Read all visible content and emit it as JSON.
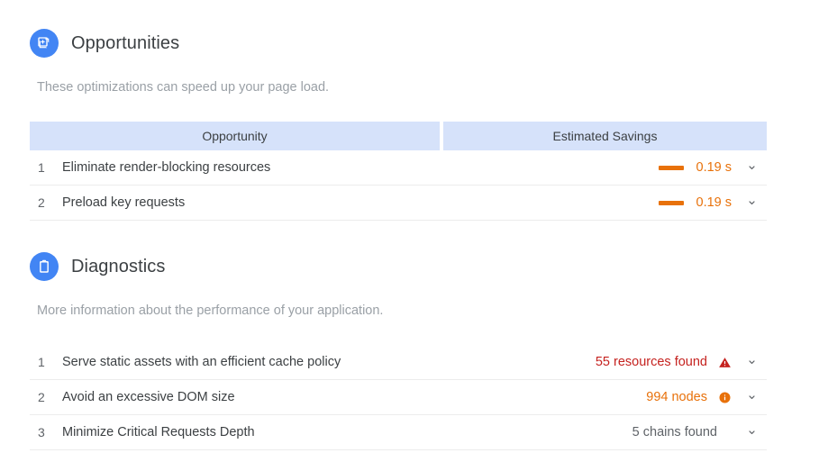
{
  "sections": [
    {
      "id": "opportunities",
      "icon_name": "opportunities-badge-icon",
      "title": "Opportunities",
      "subtitle": "These optimizations can speed up your page load.",
      "columns": {
        "left": "Opportunity",
        "right": "Estimated Savings"
      },
      "rows": [
        {
          "num": "1",
          "label": "Eliminate render-blocking resources",
          "value": "0.19 s",
          "value_color": "#e8710a",
          "has_bar": true,
          "bar_color": "#e8710a",
          "status_icon": "",
          "chevron": "chevron-down-icon"
        },
        {
          "num": "2",
          "label": "Preload key requests",
          "value": "0.19 s",
          "value_color": "#e8710a",
          "has_bar": true,
          "bar_color": "#e8710a",
          "status_icon": "",
          "chevron": "chevron-down-icon"
        }
      ]
    },
    {
      "id": "diagnostics",
      "icon_name": "diagnostics-clipboard-icon",
      "title": "Diagnostics",
      "subtitle": "More information about the performance of your application.",
      "columns": null,
      "rows": [
        {
          "num": "1",
          "label": "Serve static assets with an efficient cache policy",
          "value": "55 resources found",
          "value_color": "#c5221f",
          "has_bar": false,
          "bar_color": "",
          "status_icon": "warning-triangle-icon",
          "status_icon_color": "#c5221f",
          "chevron": "chevron-down-icon"
        },
        {
          "num": "2",
          "label": "Avoid an excessive DOM size",
          "value": "994 nodes",
          "value_color": "#e8710a",
          "has_bar": false,
          "bar_color": "",
          "status_icon": "info-circle-icon",
          "status_icon_color": "#e8710a",
          "chevron": "chevron-down-icon"
        },
        {
          "num": "3",
          "label": "Minimize Critical Requests Depth",
          "value": "5 chains found",
          "value_color": "#5f6368",
          "has_bar": false,
          "bar_color": "",
          "status_icon": "",
          "status_icon_color": "",
          "chevron": "chevron-down-icon"
        }
      ]
    }
  ],
  "theme": {
    "accent_blue": "#4285f4",
    "header_bg": "#d6e2fa",
    "orange": "#e8710a",
    "red": "#c5221f",
    "text_primary": "#3c4043",
    "text_secondary": "#5f6368",
    "text_muted": "#9aa0a6",
    "row_divider": "#ececec",
    "page_bg": "#ffffff"
  }
}
